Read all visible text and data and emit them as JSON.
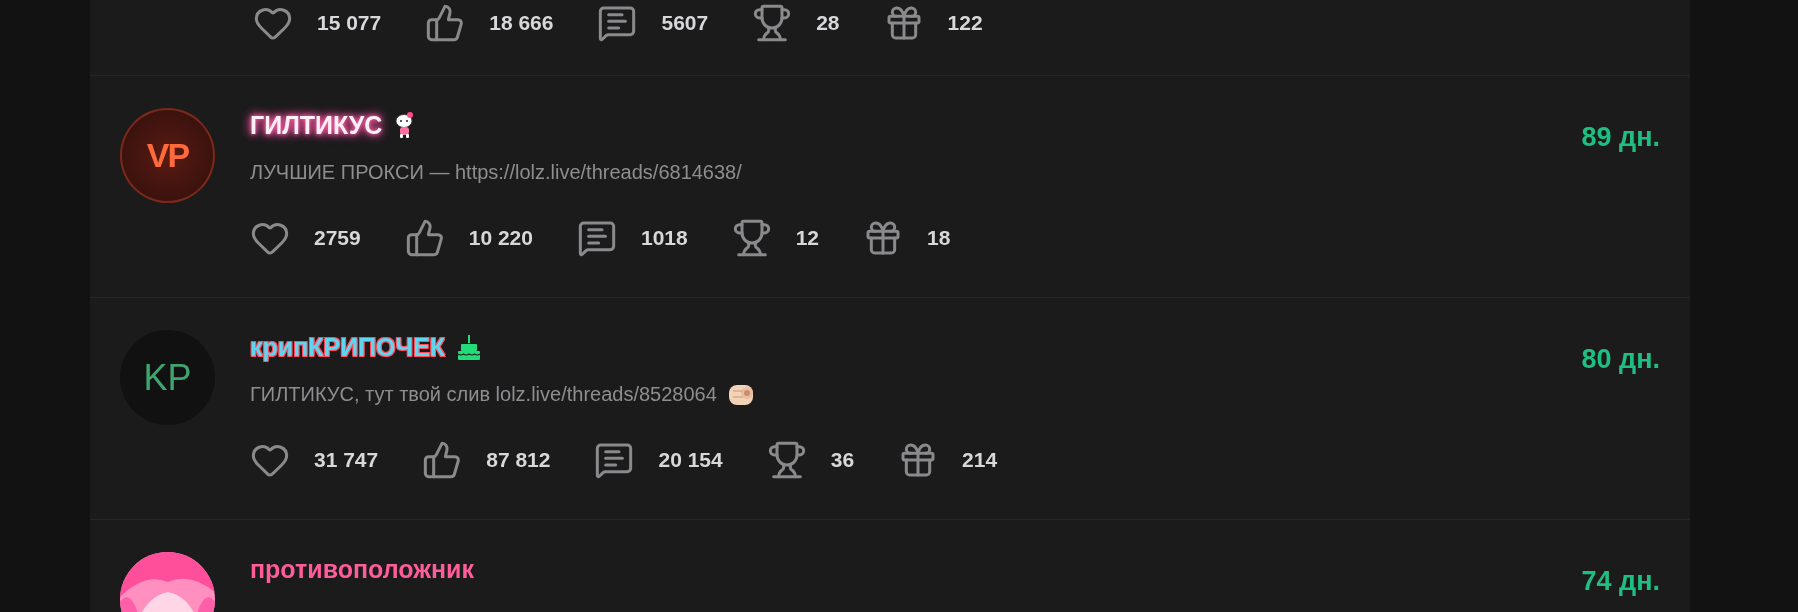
{
  "entries": [
    {
      "stats": [
        {
          "kind": "likes",
          "value": "15 077"
        },
        {
          "kind": "thumbs",
          "value": "18 666"
        },
        {
          "kind": "comments",
          "value": "5607"
        },
        {
          "kind": "trophies",
          "value": "28"
        },
        {
          "kind": "gifts",
          "value": "122"
        }
      ]
    },
    {
      "avatar": {
        "kind": "initials",
        "text": "VP"
      },
      "name": "ГИЛТИКУС",
      "message": "ЛУЧШИЕ ПРОКСИ — https://lolz.live/threads/6814638/",
      "days": "89 дн.",
      "stats": [
        {
          "kind": "likes",
          "value": "2759"
        },
        {
          "kind": "thumbs",
          "value": "10 220"
        },
        {
          "kind": "comments",
          "value": "1018"
        },
        {
          "kind": "trophies",
          "value": "12"
        },
        {
          "kind": "gifts",
          "value": "18"
        }
      ]
    },
    {
      "avatar": {
        "kind": "initials",
        "text": "KP"
      },
      "name": "крипКРИПОЧЕК",
      "message": "ГИЛТИКУС, тут твой слив lolz.live/threads/8528064",
      "days": "80 дн.",
      "stats": [
        {
          "kind": "likes",
          "value": "31 747"
        },
        {
          "kind": "thumbs",
          "value": "87 812"
        },
        {
          "kind": "comments",
          "value": "20 154"
        },
        {
          "kind": "trophies",
          "value": "36"
        },
        {
          "kind": "gifts",
          "value": "214"
        }
      ]
    },
    {
      "name": "противоположник",
      "days": "74 дн."
    }
  ]
}
